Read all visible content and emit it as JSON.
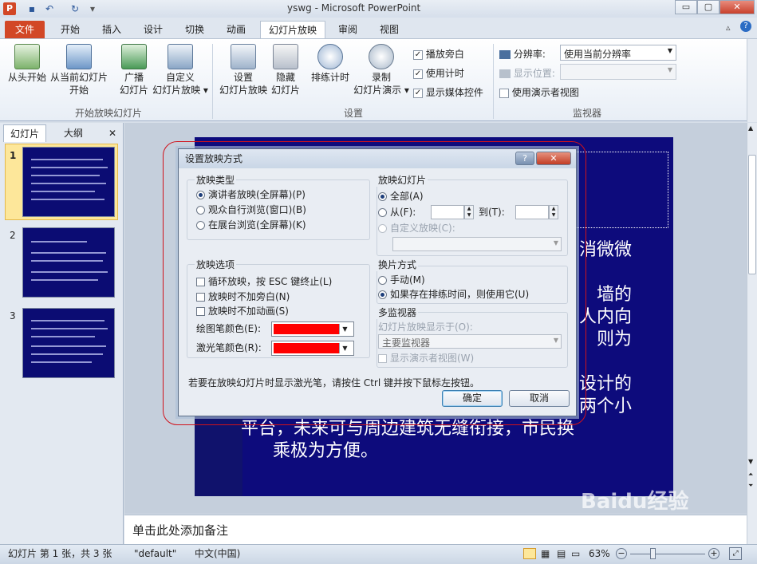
{
  "app": {
    "title": "yswg - Microsoft PowerPoint",
    "icon_letter": "P",
    "window_buttons": [
      "▭",
      "▢",
      "✕"
    ]
  },
  "tabs": {
    "file": "文件",
    "items": [
      "开始",
      "插入",
      "设计",
      "切换",
      "动画",
      "幻灯片放映",
      "审阅",
      "视图"
    ]
  },
  "ribbon": {
    "buttons": {
      "from_start": [
        "从头开始"
      ],
      "from_current": [
        "从当前幻灯片",
        "开始"
      ],
      "broadcast": [
        "广播",
        "幻灯片"
      ],
      "custom": [
        "自定义",
        "幻灯片放映 ▾"
      ],
      "setup": [
        "设置",
        "幻灯片放映"
      ],
      "hide": [
        "隐藏",
        "幻灯片"
      ],
      "rehearse": [
        "排练计时"
      ],
      "record": [
        "录制",
        "幻灯片演示 ▾"
      ]
    },
    "checks": {
      "narration": "播放旁白",
      "timings": "使用计时",
      "media_controls": "显示媒体控件"
    },
    "monitor": {
      "resolution_label": "分辨率:",
      "resolution_value": "使用当前分辨率",
      "show_on_label": "显示位置:",
      "presenter_view": "使用演示者视图"
    },
    "groups": {
      "start": "开始放映幻灯片",
      "setup": "设置",
      "monitors": "监视器"
    }
  },
  "left_panel": {
    "tab_slides": "幻灯片",
    "tab_outline": "大纲",
    "close": "✕",
    "slide_numbers": [
      "1",
      "2",
      "3"
    ]
  },
  "slide": {
    "lines": [
      "消微微",
      "",
      "墙的",
      "人内向",
      "则为",
      "",
      "设计的",
      "两个小",
      "平台，未来可与周边建筑无缝衔接，市民换",
      "乘极为方便。"
    ]
  },
  "notes_placeholder": "单击此处添加备注",
  "status": {
    "slide_info": "幻灯片 第 1 张，共 3 张",
    "theme": "\"default\"",
    "language": "中文(中国)",
    "zoom": "63%"
  },
  "dialog": {
    "title": "设置放映方式",
    "help": "?",
    "close": "✕",
    "show_type": {
      "legend": "放映类型",
      "options": [
        "演讲者放映(全屏幕)(P)",
        "观众自行浏览(窗口)(B)",
        "在展台浏览(全屏幕)(K)"
      ],
      "selected": 0
    },
    "show_slides": {
      "legend": "放映幻灯片",
      "all": "全部(A)",
      "from": "从(F):",
      "to": "到(T):",
      "custom": "自定义放映(C):"
    },
    "show_options": {
      "legend": "放映选项",
      "loop": "循环放映，按 ESC 键终止(L)",
      "no_narration": "放映时不加旁白(N)",
      "no_animation": "放映时不加动画(S)",
      "pen_color": "绘图笔颜色(E):",
      "laser_color": "激光笔颜色(R):",
      "pen_color_value": "#ff0000",
      "laser_color_value": "#ff0000"
    },
    "advance": {
      "legend": "换片方式",
      "manual": "手动(M)",
      "timings": "如果存在排练时间，则使用它(U)"
    },
    "multi_monitor": {
      "legend": "多监视器",
      "display_on": "幻灯片放映显示于(O):",
      "monitor_value": "主要监视器",
      "presenter_view": "显示演示者视图(W)"
    },
    "hint": "若要在放映幻灯片时显示激光笔，请按住 Ctrl 键并按下鼠标左按钮。",
    "ok": "确定",
    "cancel": "取消"
  },
  "watermark": "Baidu经验"
}
